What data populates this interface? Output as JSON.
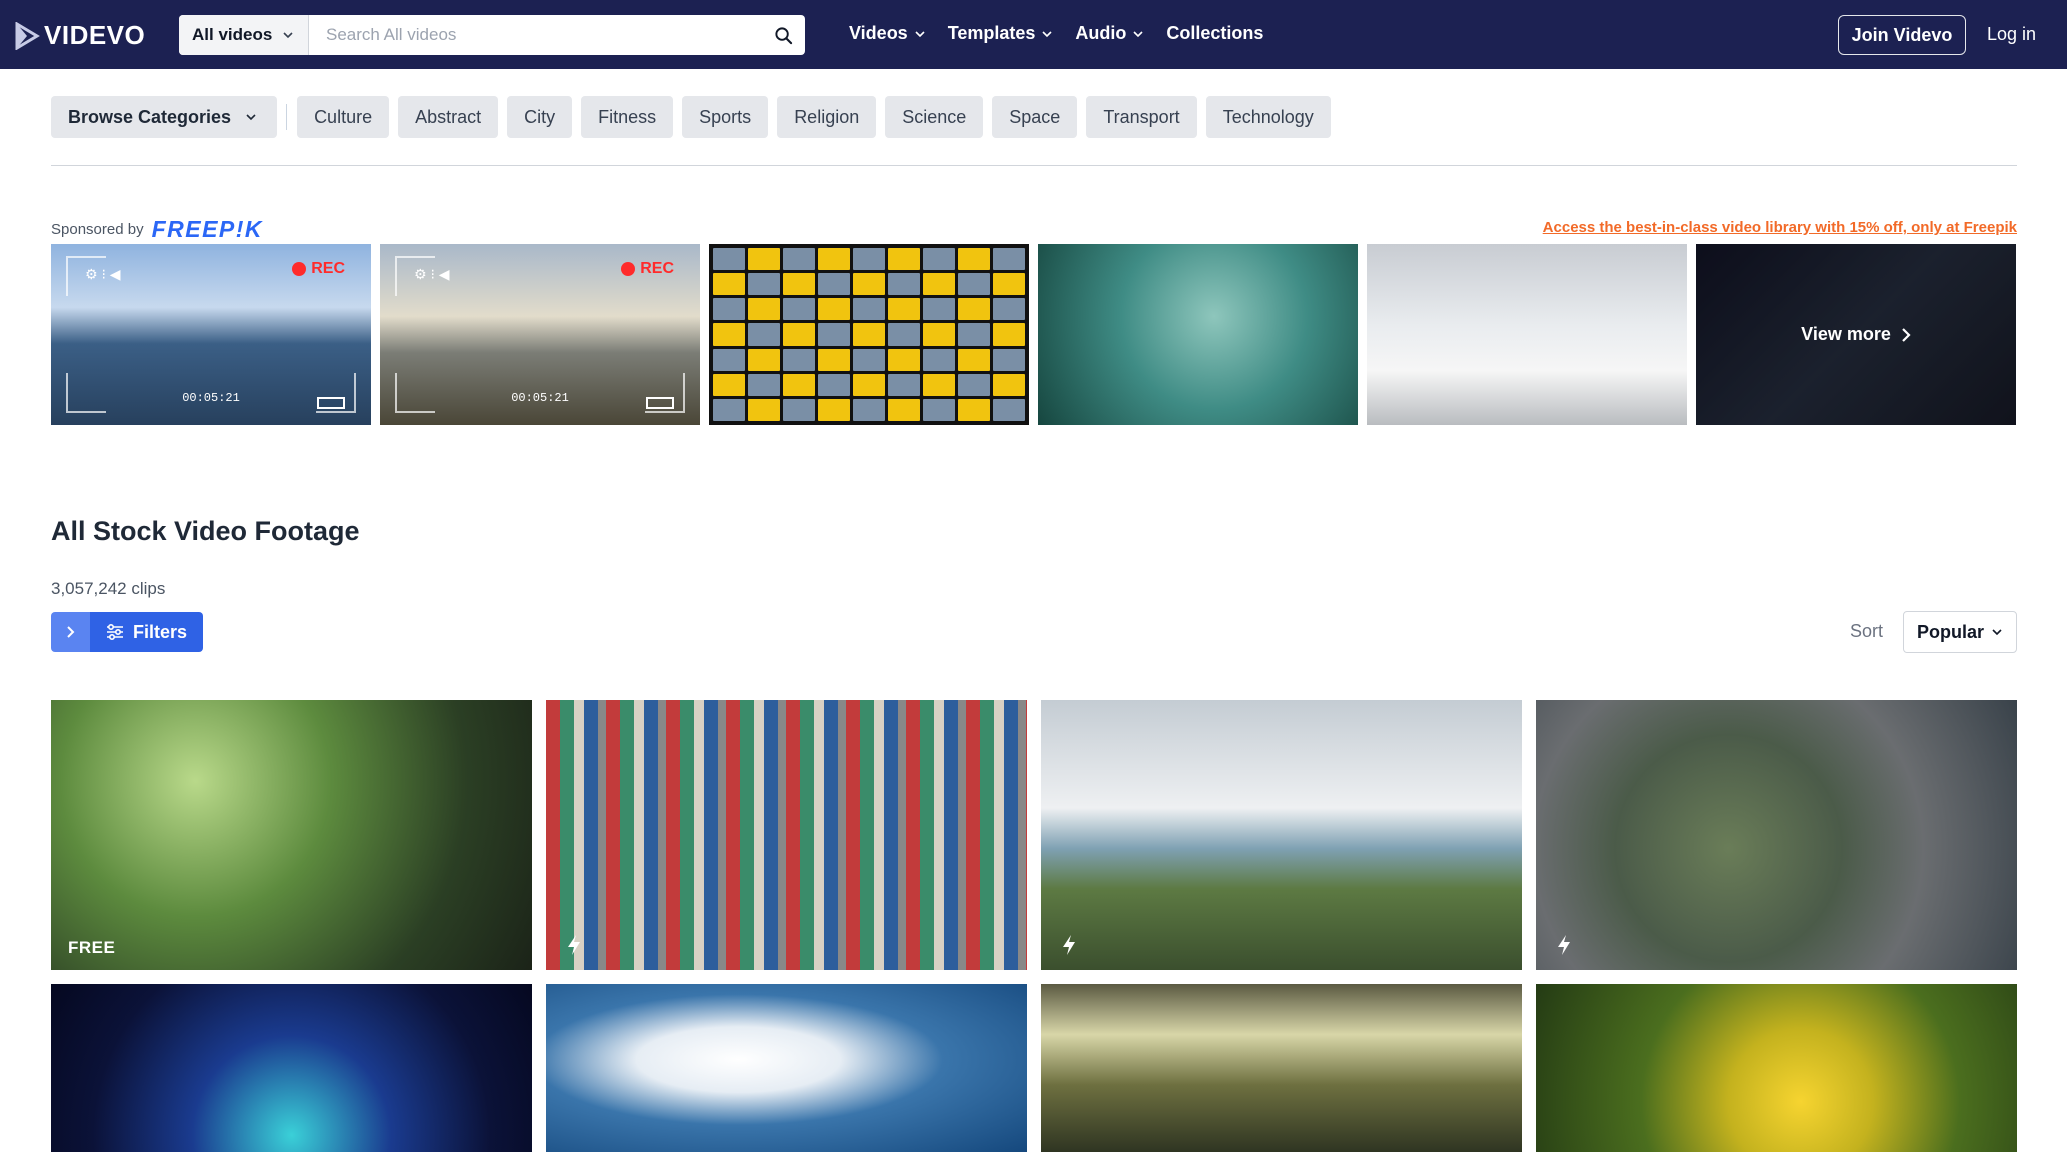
{
  "brand": {
    "name": "VIDEVO"
  },
  "search": {
    "scope": "All videos",
    "placeholder": "Search All videos"
  },
  "nav": {
    "items": [
      {
        "label": "Videos",
        "has_dropdown": true
      },
      {
        "label": "Templates",
        "has_dropdown": true
      },
      {
        "label": "Audio",
        "has_dropdown": true
      },
      {
        "label": "Collections",
        "has_dropdown": false
      }
    ],
    "join_label": "Join Videvo",
    "login_label": "Log in"
  },
  "categories": {
    "browse_label": "Browse Categories",
    "chips": [
      "Culture",
      "Abstract",
      "City",
      "Fitness",
      "Sports",
      "Religion",
      "Science",
      "Space",
      "Transport",
      "Technology"
    ]
  },
  "sponsored": {
    "prefix": "Sponsored by",
    "brand": "FREEP!K",
    "promo": "Access the best-in-class video library with 15% off, only at Freepik",
    "rec_label": "REC",
    "timecode": "00:05:21",
    "view_more_label": "View more"
  },
  "listing": {
    "title": "All Stock Video Footage",
    "count": "3,057,242 clips",
    "filters_label": "Filters",
    "sort_label": "Sort",
    "sort_value": "Popular"
  },
  "videos": [
    {
      "badge": "FREE"
    },
    {
      "badge": "premium"
    },
    {
      "badge": "premium"
    },
    {
      "badge": "premium"
    },
    {
      "badge": ""
    },
    {
      "badge": ""
    },
    {
      "badge": ""
    },
    {
      "badge": ""
    }
  ],
  "colors": {
    "nav_bg": "#1c2152",
    "accent_blue": "#2f62e5",
    "promo_orange": "#f26a28",
    "rec_red": "#ff2b2b",
    "freepik_blue": "#2b67f6"
  }
}
